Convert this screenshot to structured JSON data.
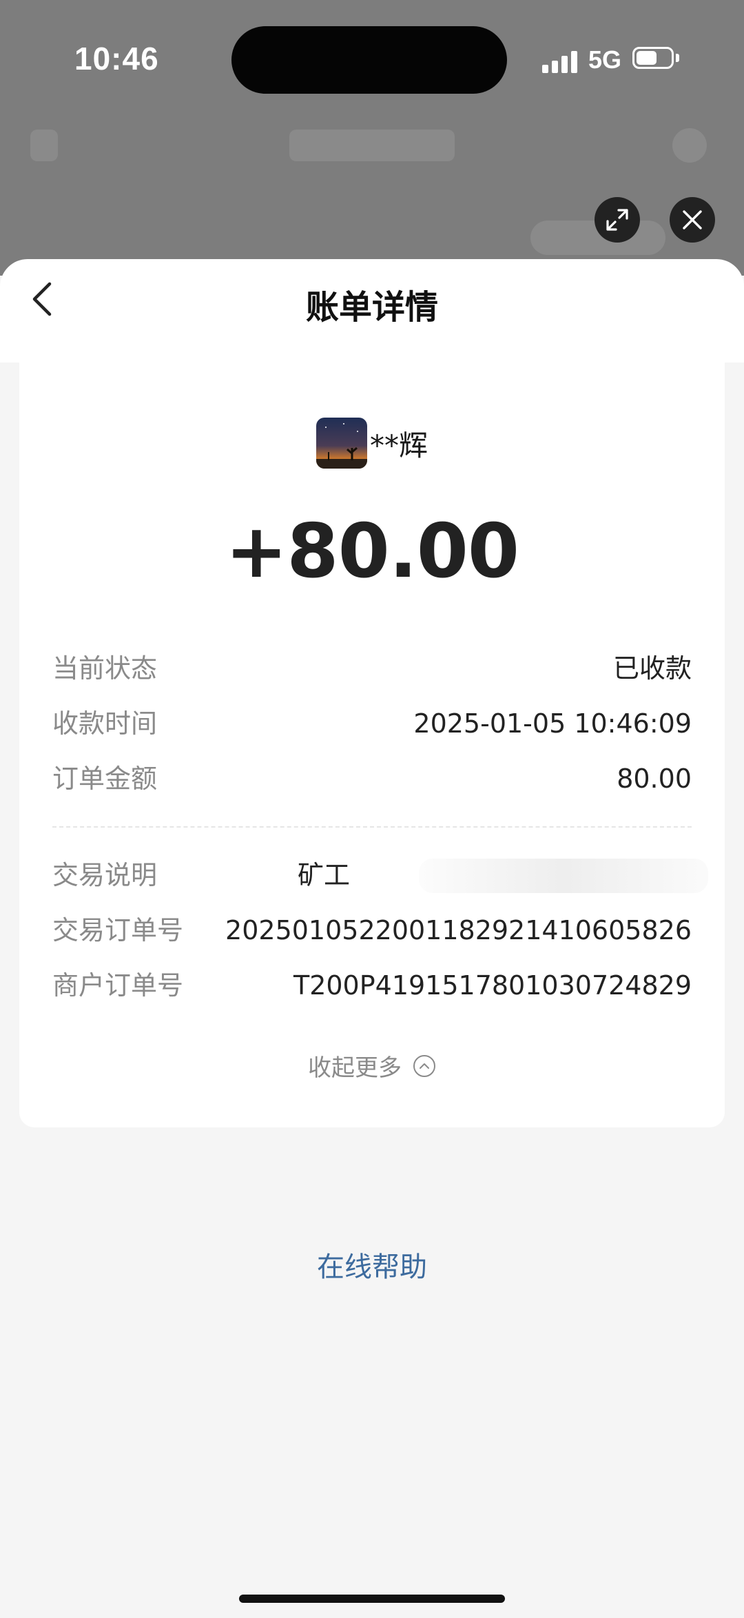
{
  "status_bar": {
    "time": "10:46",
    "network": "5G",
    "battery_level": 0.6
  },
  "controls": {
    "expand_icon": "expand-icon",
    "close_icon": "close-icon"
  },
  "header": {
    "back_icon": "chevron-left-icon",
    "title": "账单详情"
  },
  "payer": {
    "name": "**辉"
  },
  "amount": "+80.00",
  "details": [
    {
      "label": "当前状态",
      "value": "已收款"
    },
    {
      "label": "收款时间",
      "value": "2025-01-05 10:46:09"
    },
    {
      "label": "订单金额",
      "value": "80.00"
    }
  ],
  "extra_details": [
    {
      "label": "交易说明",
      "value": "矿工"
    },
    {
      "label": "交易订单号",
      "value": "2025010522001182921410605826"
    },
    {
      "label": "商户订单号",
      "value": "T200P4191517801030724829"
    }
  ],
  "collapse_label": "收起更多",
  "help_link": "在线帮助",
  "colors": {
    "link": "#3d6b9e",
    "label": "#8a8a8a",
    "value": "#222222"
  }
}
